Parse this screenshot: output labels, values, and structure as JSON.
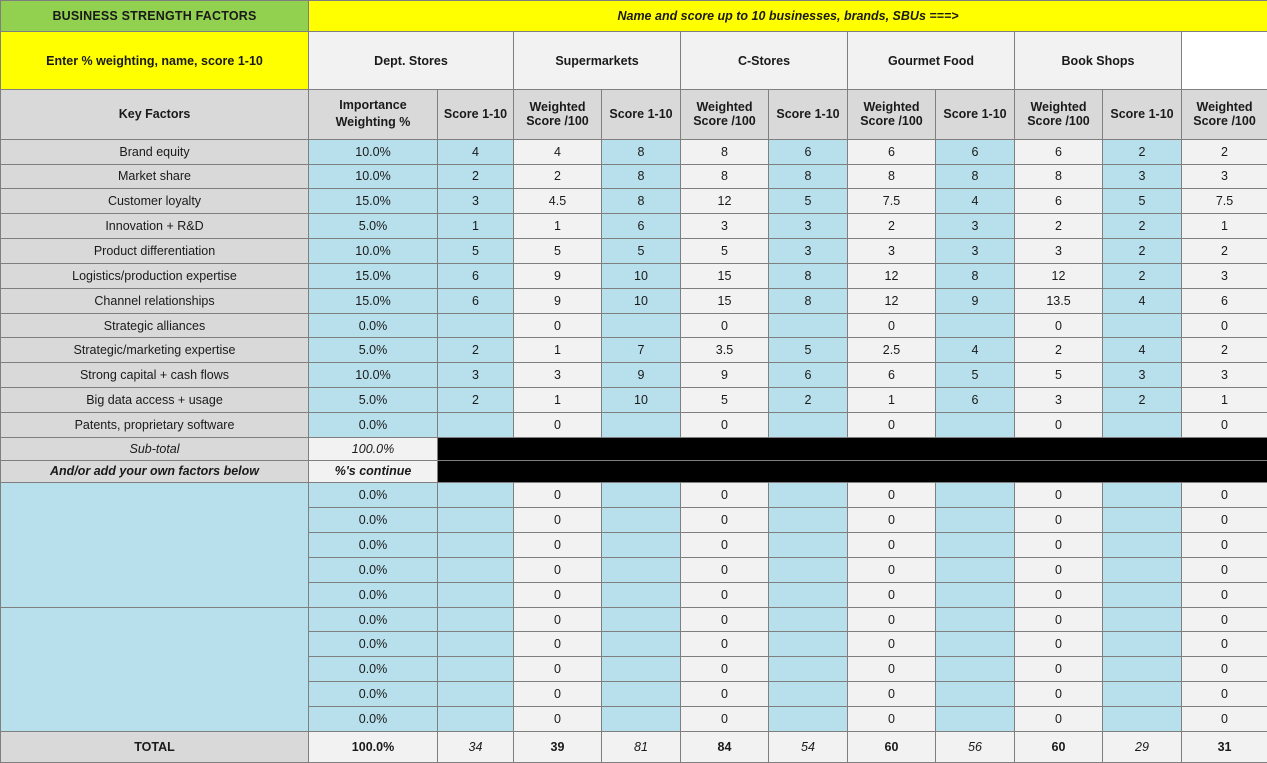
{
  "header": {
    "title_left": "BUSINESS STRENGTH FACTORS",
    "title_right": "Name and score up to 10 businesses, brands, SBUs ===>",
    "instruction": "Enter % weighting, name, score 1-10",
    "key_factors_label": "Key Factors",
    "importance_label": "Importance\nWeighting %",
    "importance_label_line1": "Importance",
    "importance_label_line2": "Weighting %",
    "score_label": "Score 1-10",
    "weighted_label_line1": "Weighted",
    "weighted_label_line2": "Score /100"
  },
  "colors": {
    "green": "#92d050",
    "yellow": "#ffff00",
    "grey": "#d9d9d9",
    "blue": "#b8e0ec",
    "white": "#f2f2f2",
    "black": "#000000"
  },
  "businesses": [
    {
      "name": "Dept. Stores"
    },
    {
      "name": "Supermarkets"
    },
    {
      "name": "C-Stores"
    },
    {
      "name": "Gourmet Food"
    },
    {
      "name": "Book Shops"
    }
  ],
  "chart_data": {
    "type": "table",
    "title": "BUSINESS STRENGTH FACTORS",
    "categories": [
      "Dept. Stores",
      "Supermarkets",
      "C-Stores",
      "Gourmet Food",
      "Book Shops"
    ],
    "series": [
      {
        "name": "Dept. Stores",
        "values": [
          4,
          2,
          3,
          1,
          5,
          6,
          6,
          null,
          2,
          3,
          2,
          null
        ]
      },
      {
        "name": "Supermarkets",
        "values": [
          8,
          8,
          8,
          6,
          5,
          10,
          10,
          null,
          7,
          9,
          10,
          null
        ]
      },
      {
        "name": "C-Stores",
        "values": [
          6,
          8,
          5,
          3,
          3,
          8,
          8,
          null,
          5,
          6,
          2,
          null
        ]
      },
      {
        "name": "Gourmet Food",
        "values": [
          6,
          8,
          4,
          3,
          3,
          8,
          9,
          null,
          4,
          5,
          6,
          null
        ]
      },
      {
        "name": "Book Shops",
        "values": [
          2,
          3,
          5,
          2,
          2,
          2,
          4,
          null,
          4,
          3,
          2,
          null
        ]
      }
    ],
    "weights": [
      10.0,
      10.0,
      15.0,
      5.0,
      10.0,
      15.0,
      15.0,
      0.0,
      5.0,
      10.0,
      5.0,
      0.0
    ],
    "totals_score": [
      34,
      81,
      54,
      56,
      29
    ],
    "totals_weighted": [
      39,
      84,
      60,
      60,
      31
    ]
  },
  "rows": [
    {
      "factor": "Brand equity",
      "weight": "10.0%",
      "cells": [
        {
          "score": "4",
          "weighted": "4"
        },
        {
          "score": "8",
          "weighted": "8"
        },
        {
          "score": "6",
          "weighted": "6"
        },
        {
          "score": "6",
          "weighted": "6"
        },
        {
          "score": "2",
          "weighted": "2"
        }
      ],
      "group_start": true
    },
    {
      "factor": "Market share",
      "weight": "10.0%",
      "cells": [
        {
          "score": "2",
          "weighted": "2"
        },
        {
          "score": "8",
          "weighted": "8"
        },
        {
          "score": "8",
          "weighted": "8"
        },
        {
          "score": "8",
          "weighted": "8"
        },
        {
          "score": "3",
          "weighted": "3"
        }
      ],
      "group_start": false
    },
    {
      "factor": "Customer loyalty",
      "weight": "15.0%",
      "cells": [
        {
          "score": "3",
          "weighted": "4.5"
        },
        {
          "score": "8",
          "weighted": "12"
        },
        {
          "score": "5",
          "weighted": "7.5"
        },
        {
          "score": "4",
          "weighted": "6"
        },
        {
          "score": "5",
          "weighted": "7.5"
        }
      ],
      "group_start": false
    },
    {
      "factor": "Innovation + R&D",
      "weight": "5.0%",
      "cells": [
        {
          "score": "1",
          "weighted": "1"
        },
        {
          "score": "6",
          "weighted": "3"
        },
        {
          "score": "3",
          "weighted": "2"
        },
        {
          "score": "3",
          "weighted": "2"
        },
        {
          "score": "2",
          "weighted": "1"
        }
      ],
      "group_start": true
    },
    {
      "factor": "Product differentiation",
      "weight": "10.0%",
      "cells": [
        {
          "score": "5",
          "weighted": "5"
        },
        {
          "score": "5",
          "weighted": "5"
        },
        {
          "score": "3",
          "weighted": "3"
        },
        {
          "score": "3",
          "weighted": "3"
        },
        {
          "score": "2",
          "weighted": "2"
        }
      ],
      "group_start": false
    },
    {
      "factor": "Logistics/production expertise",
      "weight": "15.0%",
      "cells": [
        {
          "score": "6",
          "weighted": "9"
        },
        {
          "score": "10",
          "weighted": "15"
        },
        {
          "score": "8",
          "weighted": "12"
        },
        {
          "score": "8",
          "weighted": "12"
        },
        {
          "score": "2",
          "weighted": "3"
        }
      ],
      "group_start": false
    },
    {
      "factor": "Channel relationships",
      "weight": "15.0%",
      "cells": [
        {
          "score": "6",
          "weighted": "9"
        },
        {
          "score": "10",
          "weighted": "15"
        },
        {
          "score": "8",
          "weighted": "12"
        },
        {
          "score": "9",
          "weighted": "13.5"
        },
        {
          "score": "4",
          "weighted": "6"
        }
      ],
      "group_start": true
    },
    {
      "factor": "Strategic alliances",
      "weight": "0.0%",
      "cells": [
        {
          "score": "",
          "weighted": "0"
        },
        {
          "score": "",
          "weighted": "0"
        },
        {
          "score": "",
          "weighted": "0"
        },
        {
          "score": "",
          "weighted": "0"
        },
        {
          "score": "",
          "weighted": "0"
        }
      ],
      "group_start": false
    },
    {
      "factor": "Strategic/marketing expertise",
      "weight": "5.0%",
      "cells": [
        {
          "score": "2",
          "weighted": "1"
        },
        {
          "score": "7",
          "weighted": "3.5"
        },
        {
          "score": "5",
          "weighted": "2.5"
        },
        {
          "score": "4",
          "weighted": "2"
        },
        {
          "score": "4",
          "weighted": "2"
        }
      ],
      "group_start": false
    },
    {
      "factor": "Strong capital + cash flows",
      "weight": "10.0%",
      "cells": [
        {
          "score": "3",
          "weighted": "3"
        },
        {
          "score": "9",
          "weighted": "9"
        },
        {
          "score": "6",
          "weighted": "6"
        },
        {
          "score": "5",
          "weighted": "5"
        },
        {
          "score": "3",
          "weighted": "3"
        }
      ],
      "group_start": true
    },
    {
      "factor": "Big data access + usage",
      "weight": "5.0%",
      "cells": [
        {
          "score": "2",
          "weighted": "1"
        },
        {
          "score": "10",
          "weighted": "5"
        },
        {
          "score": "2",
          "weighted": "1"
        },
        {
          "score": "6",
          "weighted": "3"
        },
        {
          "score": "2",
          "weighted": "1"
        }
      ],
      "group_start": false
    },
    {
      "factor": "Patents, proprietary software",
      "weight": "0.0%",
      "cells": [
        {
          "score": "",
          "weighted": "0"
        },
        {
          "score": "",
          "weighted": "0"
        },
        {
          "score": "",
          "weighted": "0"
        },
        {
          "score": "",
          "weighted": "0"
        },
        {
          "score": "",
          "weighted": "0"
        }
      ],
      "group_start": false
    }
  ],
  "subtotal": {
    "label": "Sub-total",
    "value": "100.0%"
  },
  "addrow": {
    "label": "And/or add your own factors below",
    "value": "%'s continue"
  },
  "blank_rows_group1": [
    {
      "factor": "",
      "weight": "0.0%",
      "cells": [
        {
          "score": "",
          "weighted": "0"
        },
        {
          "score": "",
          "weighted": "0"
        },
        {
          "score": "",
          "weighted": "0"
        },
        {
          "score": "",
          "weighted": "0"
        },
        {
          "score": "",
          "weighted": "0"
        }
      ]
    },
    {
      "factor": "",
      "weight": "0.0%",
      "cells": [
        {
          "score": "",
          "weighted": "0"
        },
        {
          "score": "",
          "weighted": "0"
        },
        {
          "score": "",
          "weighted": "0"
        },
        {
          "score": "",
          "weighted": "0"
        },
        {
          "score": "",
          "weighted": "0"
        }
      ]
    },
    {
      "factor": "",
      "weight": "0.0%",
      "cells": [
        {
          "score": "",
          "weighted": "0"
        },
        {
          "score": "",
          "weighted": "0"
        },
        {
          "score": "",
          "weighted": "0"
        },
        {
          "score": "",
          "weighted": "0"
        },
        {
          "score": "",
          "weighted": "0"
        }
      ]
    },
    {
      "factor": "",
      "weight": "0.0%",
      "cells": [
        {
          "score": "",
          "weighted": "0"
        },
        {
          "score": "",
          "weighted": "0"
        },
        {
          "score": "",
          "weighted": "0"
        },
        {
          "score": "",
          "weighted": "0"
        },
        {
          "score": "",
          "weighted": "0"
        }
      ]
    },
    {
      "factor": "",
      "weight": "0.0%",
      "cells": [
        {
          "score": "",
          "weighted": "0"
        },
        {
          "score": "",
          "weighted": "0"
        },
        {
          "score": "",
          "weighted": "0"
        },
        {
          "score": "",
          "weighted": "0"
        },
        {
          "score": "",
          "weighted": "0"
        }
      ]
    }
  ],
  "blank_rows_group2": [
    {
      "factor": "",
      "weight": "0.0%",
      "cells": [
        {
          "score": "",
          "weighted": "0"
        },
        {
          "score": "",
          "weighted": "0"
        },
        {
          "score": "",
          "weighted": "0"
        },
        {
          "score": "",
          "weighted": "0"
        },
        {
          "score": "",
          "weighted": "0"
        }
      ]
    },
    {
      "factor": "",
      "weight": "0.0%",
      "cells": [
        {
          "score": "",
          "weighted": "0"
        },
        {
          "score": "",
          "weighted": "0"
        },
        {
          "score": "",
          "weighted": "0"
        },
        {
          "score": "",
          "weighted": "0"
        },
        {
          "score": "",
          "weighted": "0"
        }
      ]
    },
    {
      "factor": "",
      "weight": "0.0%",
      "cells": [
        {
          "score": "",
          "weighted": "0"
        },
        {
          "score": "",
          "weighted": "0"
        },
        {
          "score": "",
          "weighted": "0"
        },
        {
          "score": "",
          "weighted": "0"
        },
        {
          "score": "",
          "weighted": "0"
        }
      ]
    },
    {
      "factor": "",
      "weight": "0.0%",
      "cells": [
        {
          "score": "",
          "weighted": "0"
        },
        {
          "score": "",
          "weighted": "0"
        },
        {
          "score": "",
          "weighted": "0"
        },
        {
          "score": "",
          "weighted": "0"
        },
        {
          "score": "",
          "weighted": "0"
        }
      ]
    },
    {
      "factor": "",
      "weight": "0.0%",
      "cells": [
        {
          "score": "",
          "weighted": "0"
        },
        {
          "score": "",
          "weighted": "0"
        },
        {
          "score": "",
          "weighted": "0"
        },
        {
          "score": "",
          "weighted": "0"
        },
        {
          "score": "",
          "weighted": "0"
        }
      ]
    }
  ],
  "total": {
    "label": "TOTAL",
    "weight": "100.0%",
    "cells": [
      {
        "score": "34",
        "weighted": "39"
      },
      {
        "score": "81",
        "weighted": "84"
      },
      {
        "score": "54",
        "weighted": "60"
      },
      {
        "score": "56",
        "weighted": "60"
      },
      {
        "score": "29",
        "weighted": "31"
      }
    ]
  }
}
